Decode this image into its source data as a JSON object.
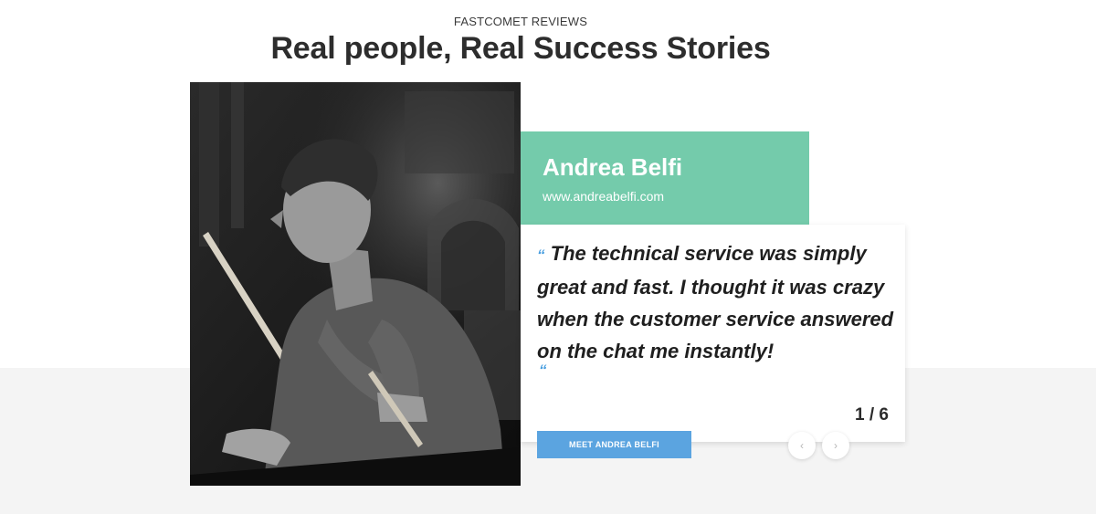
{
  "section": {
    "eyebrow": "FASTCOMET REVIEWS",
    "headline": "Real people, Real Success Stories"
  },
  "testimonial": {
    "name": "Andrea Belfi",
    "website": "www.andreabelfi.com",
    "open_quote_mark": "“",
    "quote": "The technical service was simply great and fast. I thought it was crazy when the customer service answered on the chat me instantly!",
    "close_quote_mark": "“",
    "cta_label": "MEET ANDREA BELFI",
    "photo_icon": "drummer-photo"
  },
  "pagination": {
    "counter": "1 / 6",
    "prev_icon": "‹",
    "next_icon": "›"
  },
  "colors": {
    "name_card_bg": "#74cbab",
    "cta_bg": "#5ba4e0",
    "quote_mark": "#4a9fe0",
    "band_bg": "#f4f4f4"
  }
}
